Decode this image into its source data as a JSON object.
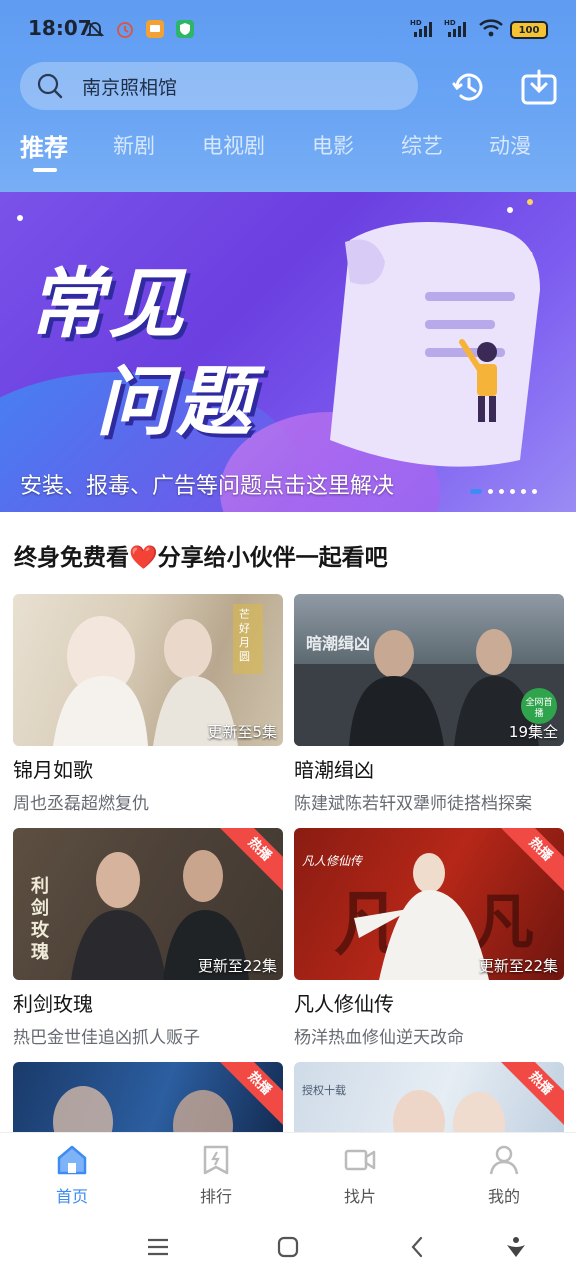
{
  "status": {
    "time": "18:07",
    "battery": "100",
    "net1": "HD",
    "net2": "HD"
  },
  "search": {
    "placeholder": "南京照相馆"
  },
  "tabs": [
    {
      "label": "推荐",
      "active": true
    },
    {
      "label": "新剧"
    },
    {
      "label": "电视剧"
    },
    {
      "label": "电影"
    },
    {
      "label": "综艺"
    },
    {
      "label": "动漫"
    }
  ],
  "banner": {
    "title_line1": "常见",
    "title_line2": "问题",
    "caption": "安装、报毒、广告等问题点击这里解决"
  },
  "section": {
    "title_part1": "终身免费看",
    "heart": "❤️",
    "title_part2": "分享给小伙伴一起看吧"
  },
  "cards": [
    {
      "name": "锦月如歌",
      "sub": "周也丞磊超燃复仇",
      "episodes": "更新至5集",
      "badge": "",
      "poster_text": "芒好月圆"
    },
    {
      "name": "暗潮缉凶",
      "sub": "陈建斌陈若轩双犟师徒搭档探案",
      "episodes": "19集全",
      "badge": "",
      "poster_text": "暗潮缉凶",
      "corner_badge": "全网首播"
    },
    {
      "name": "利剑玫瑰",
      "sub": "热巴金世佳追凶抓人贩子",
      "episodes": "更新至22集",
      "badge": "热播",
      "poster_text": "利剑玫瑰"
    },
    {
      "name": "凡人修仙传",
      "sub": "杨洋热血修仙逆天改命",
      "episodes": "更新至22集",
      "badge": "热播",
      "poster_text": "凡人修仙传"
    },
    {
      "badge": "热播"
    },
    {
      "badge": "热播",
      "poster_text": "授权十载"
    }
  ],
  "bottom_nav": [
    {
      "label": "首页",
      "icon": "home-icon",
      "active": true
    },
    {
      "label": "排行",
      "icon": "ranking-icon"
    },
    {
      "label": "找片",
      "icon": "video-search-icon"
    },
    {
      "label": "我的",
      "icon": "profile-icon"
    }
  ],
  "colors": {
    "accent": "#3d8bf3",
    "header": "#6aa5f4",
    "banner": "#7a52e9",
    "hot_ribbon": "#f14a44"
  }
}
